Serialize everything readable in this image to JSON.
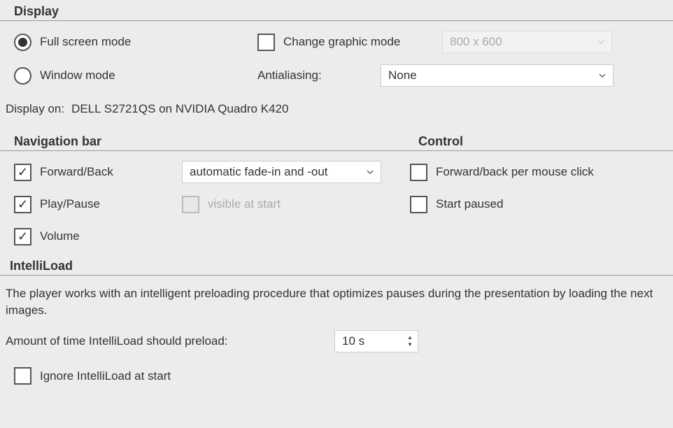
{
  "display": {
    "header": "Display",
    "full_screen_label": "Full screen mode",
    "window_label": "Window mode",
    "change_graphic_label": "Change graphic mode",
    "resolution": "800 x 600",
    "antialiasing_label": "Antialiasing:",
    "antialiasing_value": "None",
    "display_on_label": "Display on:",
    "display_on_value": "DELL S2721QS on NVIDIA Quadro K420"
  },
  "navbar": {
    "header": "Navigation bar",
    "forward_back": "Forward/Back",
    "play_pause": "Play/Pause",
    "volume": "Volume",
    "fade_mode": "automatic fade-in and -out",
    "visible_at_start": "visible at start"
  },
  "control": {
    "header": "Control",
    "fwd_back_click": "Forward/back per mouse click",
    "start_paused": "Start paused"
  },
  "intelli": {
    "header": "IntelliLoad",
    "desc": "The player works with an intelligent preloading procedure that optimizes pauses during the presentation by loading the next images.",
    "amount_label": "Amount of time IntelliLoad should preload:",
    "amount_value": "10 s",
    "ignore_label": "Ignore IntelliLoad at start"
  }
}
